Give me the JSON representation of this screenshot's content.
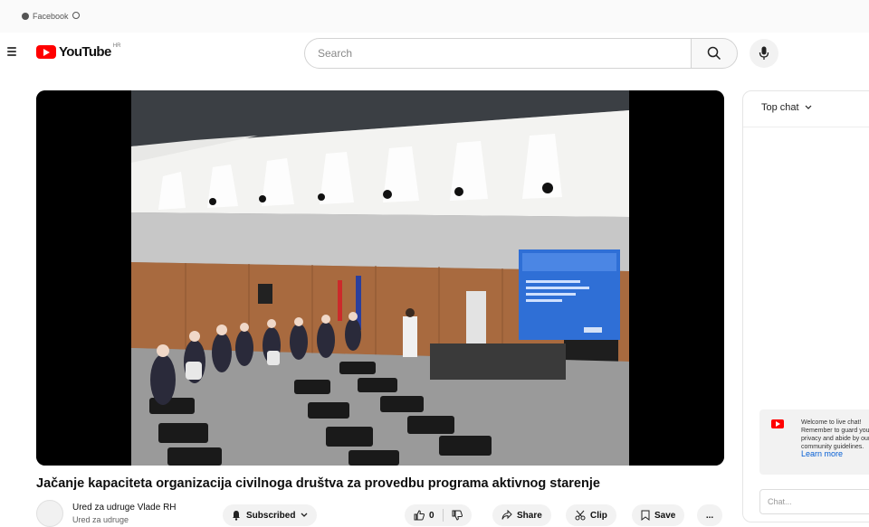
{
  "bookmarks": [
    {
      "label": "Facebook"
    },
    {
      "label": ""
    }
  ],
  "header": {
    "logo_text": "YouTube",
    "logo_country": "HR",
    "search_placeholder": "Search"
  },
  "video": {
    "title": "Jačanje kapaciteta organizacija civilnoga društva za provedbu programa aktivnog starenje",
    "channel_name": "Ured za udruge Vlade RH",
    "channel_subs": "Ured za udruge",
    "subscribe_label": "Subscribed",
    "like_count": "0",
    "share_label": "Share",
    "clip_label": "Clip",
    "save_label": "Save",
    "more_label": "..."
  },
  "chat": {
    "header_label": "Top chat",
    "welcome_text": "Welcome to live chat! Remember to guard your privacy and abide by our community guidelines.",
    "learn_more": "Learn more",
    "input_placeholder": "Chat..."
  },
  "colors": {
    "brand": "#ff0000",
    "link": "#065fd4",
    "pill_bg": "#f2f2f2",
    "screen_blue": "#2f6fd6"
  }
}
